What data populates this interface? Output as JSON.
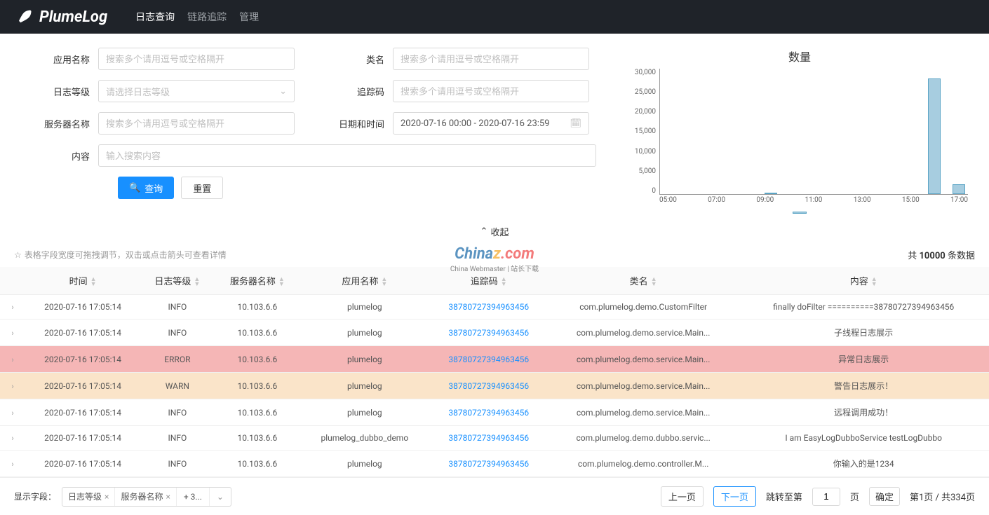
{
  "logo": "PlumeLog",
  "nav": {
    "items": [
      "日志查询",
      "链路追踪",
      "管理"
    ],
    "active": 0
  },
  "form": {
    "labels": {
      "app": "应用名称",
      "class": "类名",
      "level": "日志等级",
      "trace": "追踪码",
      "server": "服务器名称",
      "date": "日期和时间",
      "content": "内容"
    },
    "placeholders": {
      "multi": "搜索多个请用逗号或空格隔开",
      "level": "请选择日志等级",
      "content": "输入搜索内容"
    },
    "dateValue": "2020-07-16 00:00 - 2020-07-16 23:59",
    "buttons": {
      "query": "查询",
      "reset": "重置"
    }
  },
  "chart_data": {
    "type": "bar",
    "title": "数量",
    "x": [
      "05:00",
      "07:00",
      "09:00",
      "11:00",
      "13:00",
      "15:00",
      "17:00"
    ],
    "yTicks": [
      "30,000",
      "25,000",
      "20,000",
      "15,000",
      "10,000",
      "5,000",
      "0"
    ],
    "ylim": [
      0,
      30000
    ],
    "series": [
      {
        "name": "数量",
        "values": [
          0,
          0,
          100,
          0,
          0,
          0,
          27500,
          2000
        ]
      }
    ],
    "bars": [
      {
        "pos_pct": 34,
        "height_pct": 1
      },
      {
        "pos_pct": 87,
        "height_pct": 92
      },
      {
        "pos_pct": 95,
        "height_pct": 8
      }
    ]
  },
  "collapse": "收起",
  "tip": "表格字段宽度可拖拽调节，双击或点击箭头可查看详情",
  "total": {
    "prefix": "共 ",
    "count": "10000",
    "suffix": " 条数据"
  },
  "columns": [
    "时间",
    "日志等级",
    "服务器名称",
    "应用名称",
    "追踪码",
    "类名",
    "内容"
  ],
  "rows": [
    {
      "time": "2020-07-16 17:05:14",
      "level": "INFO",
      "server": "10.103.6.6",
      "app": "plumelog",
      "trace": "38780727394963456",
      "class": "com.plumelog.demo.CustomFilter",
      "content": "finally doFilter ==========38780727394963456",
      "row_class": ""
    },
    {
      "time": "2020-07-16 17:05:14",
      "level": "INFO",
      "server": "10.103.6.6",
      "app": "plumelog",
      "trace": "38780727394963456",
      "class": "com.plumelog.demo.service.Main...",
      "content": "子线程日志展示",
      "row_class": ""
    },
    {
      "time": "2020-07-16 17:05:14",
      "level": "ERROR",
      "server": "10.103.6.6",
      "app": "plumelog",
      "trace": "38780727394963456",
      "class": "com.plumelog.demo.service.Main...",
      "content": "异常日志展示",
      "row_class": "row-error"
    },
    {
      "time": "2020-07-16 17:05:14",
      "level": "WARN",
      "server": "10.103.6.6",
      "app": "plumelog",
      "trace": "38780727394963456",
      "class": "com.plumelog.demo.service.Main...",
      "content": "警告日志展示！",
      "row_class": "row-warn"
    },
    {
      "time": "2020-07-16 17:05:14",
      "level": "INFO",
      "server": "10.103.6.6",
      "app": "plumelog",
      "trace": "38780727394963456",
      "class": "com.plumelog.demo.service.Main...",
      "content": "远程调用成功！",
      "row_class": ""
    },
    {
      "time": "2020-07-16 17:05:14",
      "level": "INFO",
      "server": "10.103.6.6",
      "app": "plumelog_dubbo_demo",
      "trace": "38780727394963456",
      "class": "com.plumelog.demo.dubbo.servic...",
      "content": "I am EasyLogDubboService testLogDubbo",
      "row_class": ""
    },
    {
      "time": "2020-07-16 17:05:14",
      "level": "INFO",
      "server": "10.103.6.6",
      "app": "plumelog",
      "trace": "38780727394963456",
      "class": "com.plumelog.demo.controller.M...",
      "content": "你输入的是1234",
      "row_class": ""
    }
  ],
  "footer": {
    "fieldsLabel": "显示字段：",
    "tags": [
      "日志等级",
      "服务器名称"
    ],
    "more": "+ 3...",
    "prev": "上一页",
    "next": "下一页",
    "jumpPrefix": "跳转至第",
    "jumpSuffix": "页",
    "confirm": "确定",
    "pageInput": "1",
    "pageInfo": "第1页 / 共334页"
  },
  "watermark": {
    "main": "Chinaz",
    "suffix": ".com",
    "sub": "China Webmaster | 站长下载"
  }
}
